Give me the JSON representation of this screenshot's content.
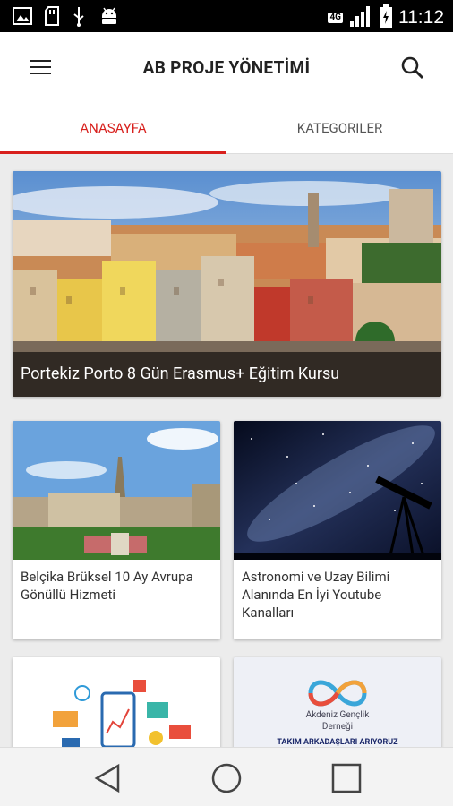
{
  "status_bar": {
    "time": "11:12",
    "network": "4G",
    "icons": [
      "image-icon",
      "sd-card-icon",
      "usb-icon",
      "android-icon",
      "signal-icon",
      "battery-icon"
    ]
  },
  "app_bar": {
    "title": "AB PROJE YÖNETİMİ",
    "menu_icon": "hamburger-menu-icon",
    "search_icon": "search-icon"
  },
  "tabs": [
    {
      "label": "ANASAYFA",
      "active": true
    },
    {
      "label": "KATEGORILER",
      "active": false
    }
  ],
  "colors": {
    "accent": "#d8201d",
    "background": "#ececec"
  },
  "featured": {
    "title": "Portekiz Porto 8 Gün Erasmus+ Eğitim Kursu",
    "image": "porto-cityscape"
  },
  "posts": [
    {
      "title": "Belçika Brüksel 10 Ay Avrupa Gönüllü Hizmeti",
      "image": "brussels-city"
    },
    {
      "title": "Astronomi ve Uzay Bilimi Alanında En İyi Youtube Kanalları",
      "image": "telescope-night-sky"
    },
    {
      "title": "",
      "image": "infographic-icons"
    },
    {
      "title": "",
      "image": "akdeniz-genclik-logo",
      "org_line1": "Akdeniz Gençlik",
      "org_line2": "Derneği",
      "banner": "TAKIM ARKADAŞLARI ARIYORUZ"
    }
  ],
  "nav_bar": {
    "buttons": [
      "back-icon",
      "home-icon",
      "recents-icon"
    ]
  }
}
